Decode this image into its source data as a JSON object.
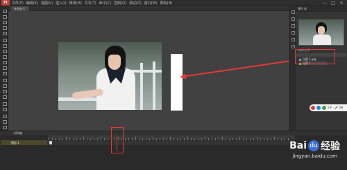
{
  "menubar": {
    "app_logo": "Fl",
    "items": [
      "文件(F)",
      "编辑(E)",
      "视图(V)",
      "插入(I)",
      "修改(M)",
      "文本(T)",
      "命令(C)",
      "控制(O)",
      "调试(D)",
      "窗口(W)",
      "帮助(H)"
    ],
    "window_buttons": [
      "—",
      "□",
      "✕"
    ]
  },
  "document_tab": "未命名-1*",
  "panel": {
    "tabs": "属性  库",
    "library_header": "未命名-1",
    "items": [
      {
        "label": "位图 1.jpg",
        "selected": false
      },
      {
        "label": "元件 1",
        "selected": true
      }
    ]
  },
  "float_bar": {
    "label": "S中 · 🎤 ⌨",
    "icon_colors": [
      "#e53935",
      "#1e88e5",
      "#43a047"
    ]
  },
  "timeline": {
    "tabs": "时间轴",
    "layer_name": "图层 1"
  },
  "watermark": {
    "logo_left": "Bai",
    "logo_right": "经验",
    "paw": "du",
    "url": "jingyan.baidu.com"
  },
  "colors": {
    "annotation": "#e53935",
    "background": "#3c3c3c"
  }
}
